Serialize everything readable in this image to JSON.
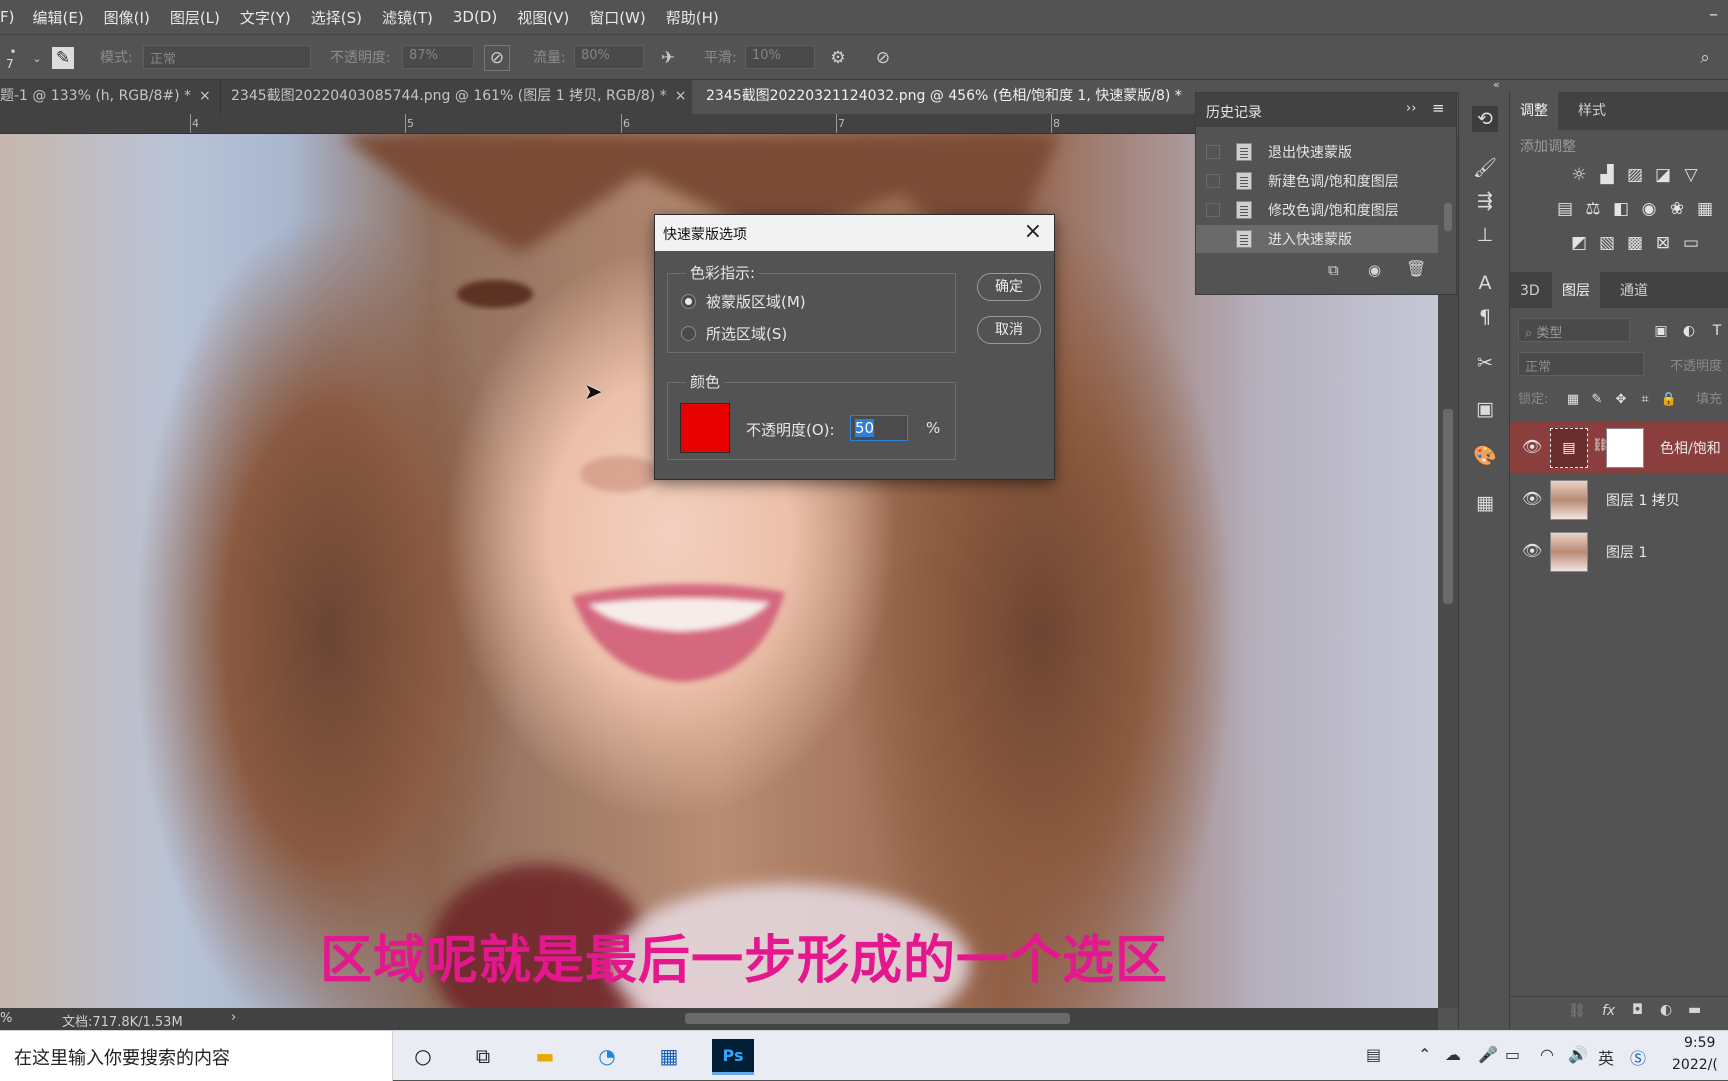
{
  "menu": [
    "F)",
    "编辑(E)",
    "图像(I)",
    "图层(L)",
    "文字(Y)",
    "选择(S)",
    "滤镜(T)",
    "3D(D)",
    "视图(V)",
    "窗口(W)",
    "帮助(H)"
  ],
  "options_bar": {
    "brush_size": "7",
    "mode_label": "模式:",
    "mode_value": "正常",
    "opacity_label": "不透明度:",
    "opacity_value": "87%",
    "flow_label": "流量:",
    "flow_value": "80%",
    "smooth_label": "平滑:",
    "smooth_value": "10%"
  },
  "tabs": [
    {
      "label": "题-1 @ 133% (h, RGB/8#) *"
    },
    {
      "label": "2345截图20220403085744.png @ 161% (图层 1 拷贝, RGB/8) *"
    },
    {
      "label": "2345截图20220321124032.png @ 456% (色相/饱和度 1, 快速蒙版/8) *"
    }
  ],
  "ruler_numbers": [
    "4",
    "5",
    "6",
    "7",
    "8"
  ],
  "subtitle": "区域呢就是最后一步形成的一个选区",
  "status": {
    "doc_info": "文档:717.8K/1.53M",
    "zoom_fragment": "%"
  },
  "history_panel": {
    "title": "历史记录",
    "items": [
      "退出快速蒙版",
      "新建色调/饱和度图层",
      "修改色调/饱和度图层",
      "进入快速蒙版"
    ]
  },
  "adjust_panel": {
    "tabs": [
      "调整",
      "样式"
    ],
    "subtitle": "添加调整"
  },
  "layers_panel": {
    "tabs": [
      "3D",
      "图层",
      "通道"
    ],
    "filter_label": "类型",
    "blend_mode": "正常",
    "opacity_label": "不透明度",
    "lock_label": "锁定:",
    "fill_label": "填充",
    "layers": [
      {
        "name": "色相/饱和",
        "selected": true
      },
      {
        "name": "图层 1 拷贝",
        "selected": false
      },
      {
        "name": "图层 1",
        "selected": false
      }
    ]
  },
  "dialog": {
    "title": "快速蒙版选项",
    "color_indicates_label": "色彩指示:",
    "option_masked": "被蒙版区域(M)",
    "option_selected": "所选区域(S)",
    "selected_option": "masked",
    "color_group_label": "颜色",
    "swatch_color": "#e60000",
    "opacity_label": "不透明度(O):",
    "opacity_value": "50",
    "opacity_unit": "%",
    "ok": "确定",
    "cancel": "取消"
  },
  "taskbar": {
    "search_placeholder": "在这里输入你要搜索的内容",
    "time": "9:59",
    "date": "2022/("
  },
  "colors": {
    "accent_subtitle": "#e5178e",
    "selected_layer": "#8a3e3e",
    "ps_blue": "#31a8ff"
  }
}
